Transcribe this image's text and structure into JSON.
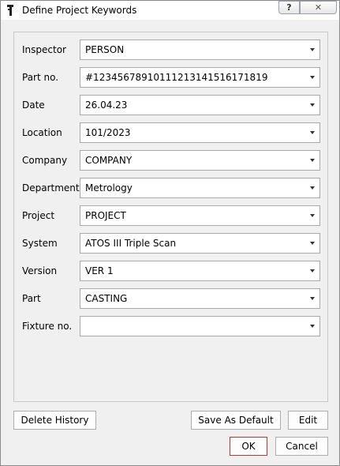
{
  "window": {
    "title": "Define Project Keywords",
    "help_label": "?",
    "close_label": "✕"
  },
  "fields": [
    {
      "label": "Inspector",
      "value": "PERSON"
    },
    {
      "label": "Part no.",
      "value": "#12345678910111213141516171819"
    },
    {
      "label": "Date",
      "value": "26.04.23"
    },
    {
      "label": "Location",
      "value": "101/2023"
    },
    {
      "label": "Company",
      "value": "COMPANY"
    },
    {
      "label": "Department",
      "value": "Metrology"
    },
    {
      "label": "Project",
      "value": "PROJECT"
    },
    {
      "label": "System",
      "value": "ATOS III Triple Scan"
    },
    {
      "label": "Version",
      "value": "VER 1"
    },
    {
      "label": "Part",
      "value": "CASTING"
    },
    {
      "label": "Fixture no.",
      "value": ""
    }
  ],
  "buttons": {
    "delete_history": "Delete History",
    "save_as_default": "Save As Default",
    "edit": "Edit",
    "ok": "OK",
    "cancel": "Cancel"
  }
}
